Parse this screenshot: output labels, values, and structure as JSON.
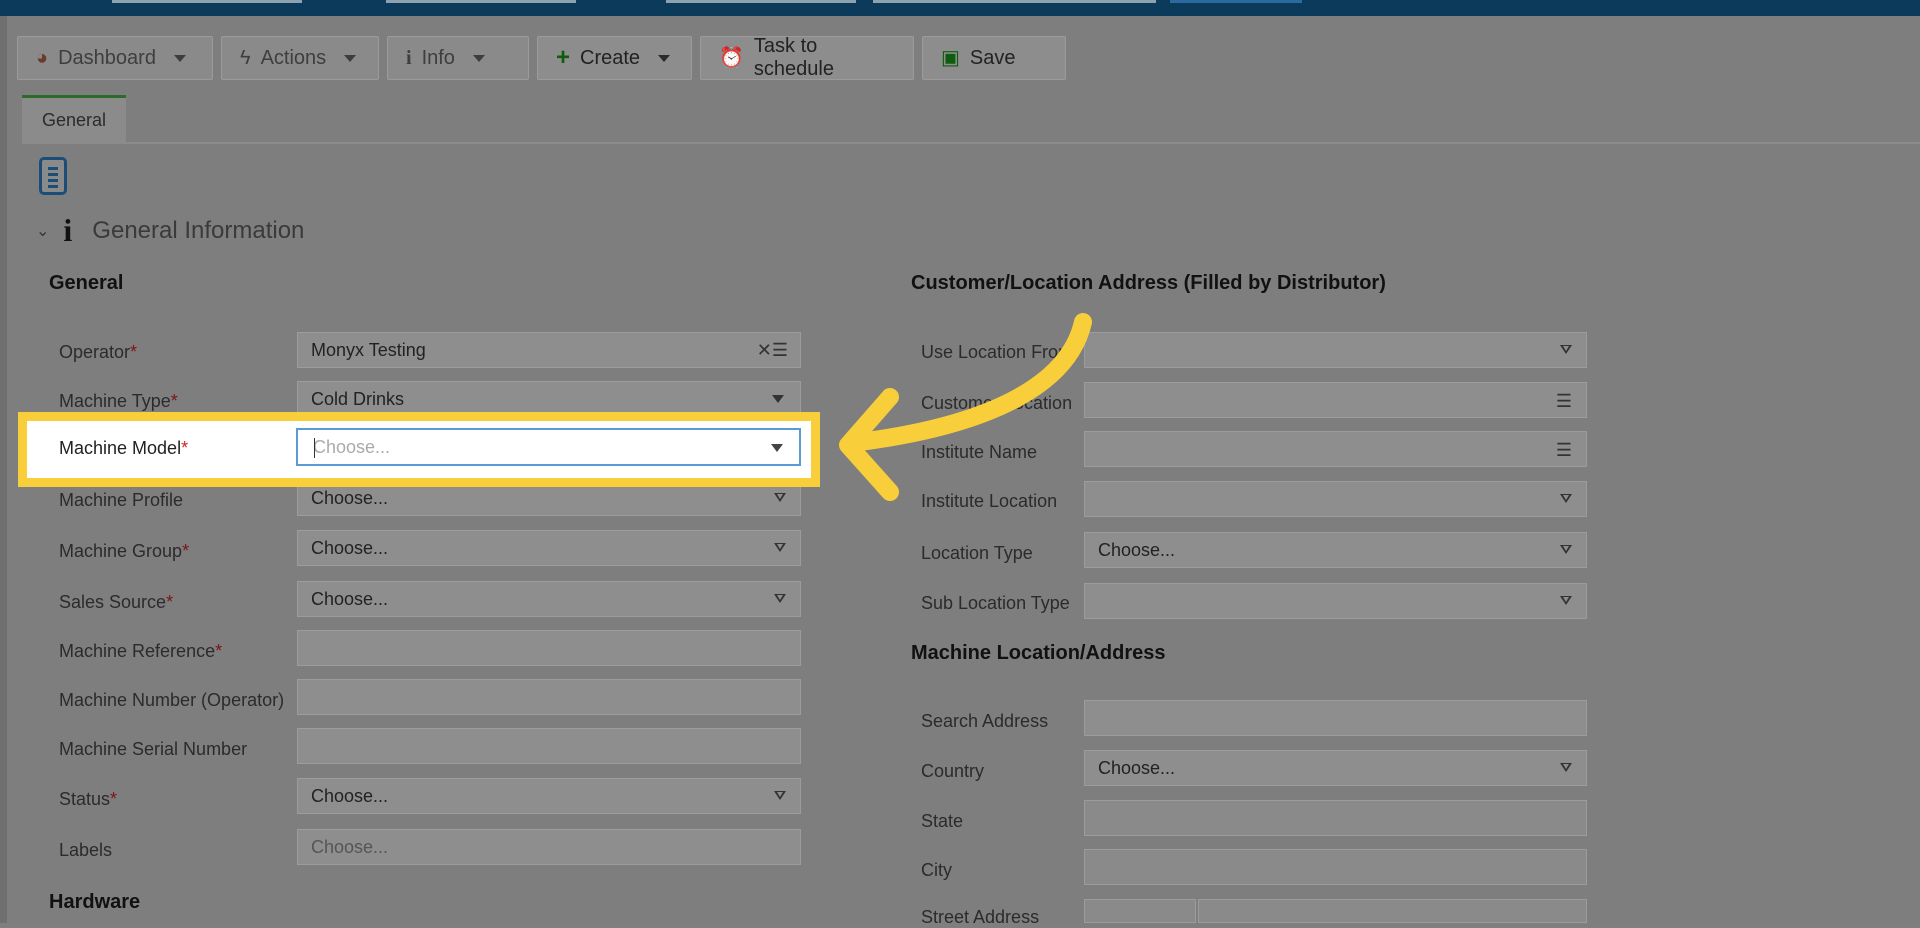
{
  "toolbar": {
    "dashboard": "Dashboard",
    "actions": "Actions",
    "info": "Info",
    "create": "Create",
    "task": "Task to schedule",
    "save": "Save"
  },
  "tabs": {
    "general": "General"
  },
  "section": {
    "title": "General Information"
  },
  "left": {
    "heading": "General",
    "operator_label": "Operator",
    "operator_value": "Monyx Testing",
    "machine_type_label": "Machine Type",
    "machine_type_value": "Cold Drinks",
    "machine_model_label": "Machine Model",
    "machine_model_placeholder": "Choose...",
    "machine_profile_label": "Machine Profile",
    "machine_profile_value": "Choose...",
    "machine_group_label": "Machine Group",
    "machine_group_value": "Choose...",
    "sales_source_label": "Sales Source",
    "sales_source_value": "Choose...",
    "machine_reference_label": "Machine Reference",
    "machine_number_label": "Machine Number (Operator)",
    "machine_serial_label": "Machine Serial Number",
    "status_label": "Status",
    "status_value": "Choose...",
    "labels_label": "Labels",
    "labels_placeholder": "Choose...",
    "hardware_heading": "Hardware",
    "required_mark": "*"
  },
  "right": {
    "heading": "Customer/Location Address (Filled by Distributor)",
    "use_location_label": "Use Location From",
    "customer_location_label": "Customer/Location",
    "institute_name_label": "Institute Name",
    "institute_location_label": "Institute Location",
    "location_type_label": "Location Type",
    "location_type_value": "Choose...",
    "sub_location_type_label": "Sub Location Type",
    "machine_location_heading": "Machine Location/Address",
    "search_address_label": "Search Address",
    "country_label": "Country",
    "country_value": "Choose...",
    "state_label": "State",
    "city_label": "City",
    "street_address_label": "Street Address"
  },
  "colors": {
    "highlight": "#f8cf3a",
    "focus_border": "#5b9bd5",
    "required": "#c62828",
    "topbar": "#0b3a5a"
  }
}
